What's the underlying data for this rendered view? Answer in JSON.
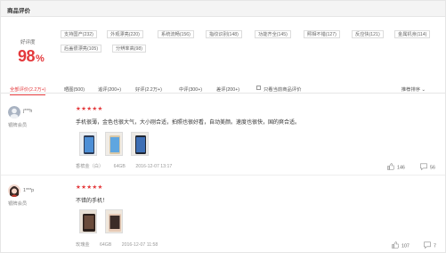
{
  "section_title": "商品评价",
  "rating": {
    "label": "好评度",
    "value": "98",
    "unit": "%"
  },
  "tags": [
    "支持国产(232)",
    "外观漂亮(220)",
    "系统流畅(156)",
    "指纹识别(148)",
    "功能齐全(145)",
    "照相不错(127)",
    "反应快(121)",
    "金属机身(114)",
    "后盖很漂亮(105)",
    "分辨率高(98)"
  ],
  "filters": {
    "all": "全部评价(2.2万+)",
    "photo": "晒图(500)",
    "append": "追评(200+)",
    "good": "好评(2.2万+)",
    "mid": "中评(300+)",
    "bad": "差评(200+)",
    "only_current": "只看当前商品评价",
    "sort": "推荐排序"
  },
  "reviews": [
    {
      "user": "j***h",
      "level": "银牌会员",
      "stars": "★★★★★",
      "text": "手机很薄，金色也很大气，大小刚合适，拍照也很好看，自动美颜。速度也很快，国的爽合适。",
      "color": "香槟金（白）",
      "storage": "64GB",
      "date": "2016-12-07 13:17",
      "likes": "146",
      "comments": "56"
    },
    {
      "user": "1***p",
      "level": "银牌会员",
      "stars": "★★★★★",
      "text": "不错的手机！",
      "color": "玫瑰金",
      "storage": "64GB",
      "date": "2016-12-07 11:58",
      "likes": "107",
      "comments": "7"
    }
  ],
  "colors": {
    "accent": "#e4393c",
    "border": "#e6e6e6",
    "header_bg": "#f4f4f4"
  }
}
